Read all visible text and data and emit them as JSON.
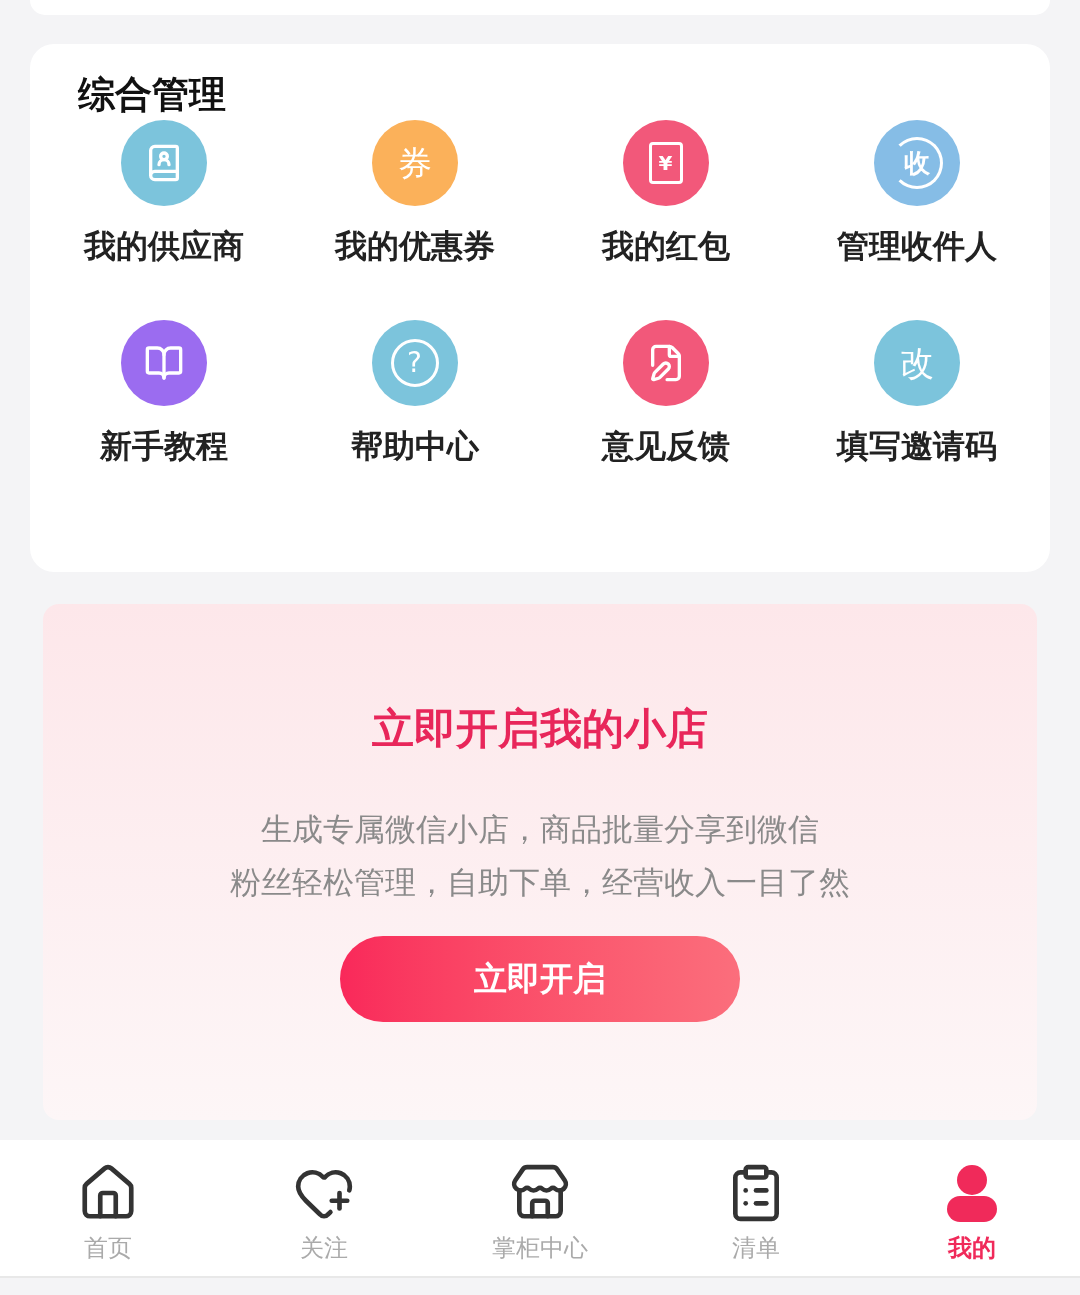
{
  "section": {
    "title": "综合管理",
    "items": [
      {
        "label": "我的供应商",
        "kind": "contacts",
        "color": "#7cc4dc"
      },
      {
        "label": "我的优惠券",
        "kind": "glyph",
        "glyph": "券",
        "color": "#fbb15a"
      },
      {
        "label": "我的红包",
        "kind": "envelope",
        "glyph": "¥",
        "color": "#f2587a"
      },
      {
        "label": "管理收件人",
        "kind": "cycle",
        "glyph": "收",
        "color": "#86bde6"
      },
      {
        "label": "新手教程",
        "kind": "book",
        "color": "#9b6cf0"
      },
      {
        "label": "帮助中心",
        "kind": "help",
        "glyph": "?",
        "color": "#7cc4dc"
      },
      {
        "label": "意见反馈",
        "kind": "note",
        "color": "#f2587a"
      },
      {
        "label": "填写邀请码",
        "kind": "glyph",
        "glyph": "改",
        "color": "#7cc4dc"
      }
    ]
  },
  "promo": {
    "title": "立即开启我的小店",
    "lines": [
      "生成专属微信小店，商品批量分享到微信",
      "粉丝轻松管理，自助下单，经营收入一目了然"
    ],
    "button": "立即开启"
  },
  "nav": [
    {
      "label": "首页",
      "kind": "home",
      "selected": false
    },
    {
      "label": "关注",
      "kind": "heart",
      "selected": false
    },
    {
      "label": "掌柜中心",
      "kind": "store",
      "selected": false
    },
    {
      "label": "清单",
      "kind": "list",
      "selected": false
    },
    {
      "label": "我的",
      "kind": "me",
      "selected": true
    }
  ]
}
